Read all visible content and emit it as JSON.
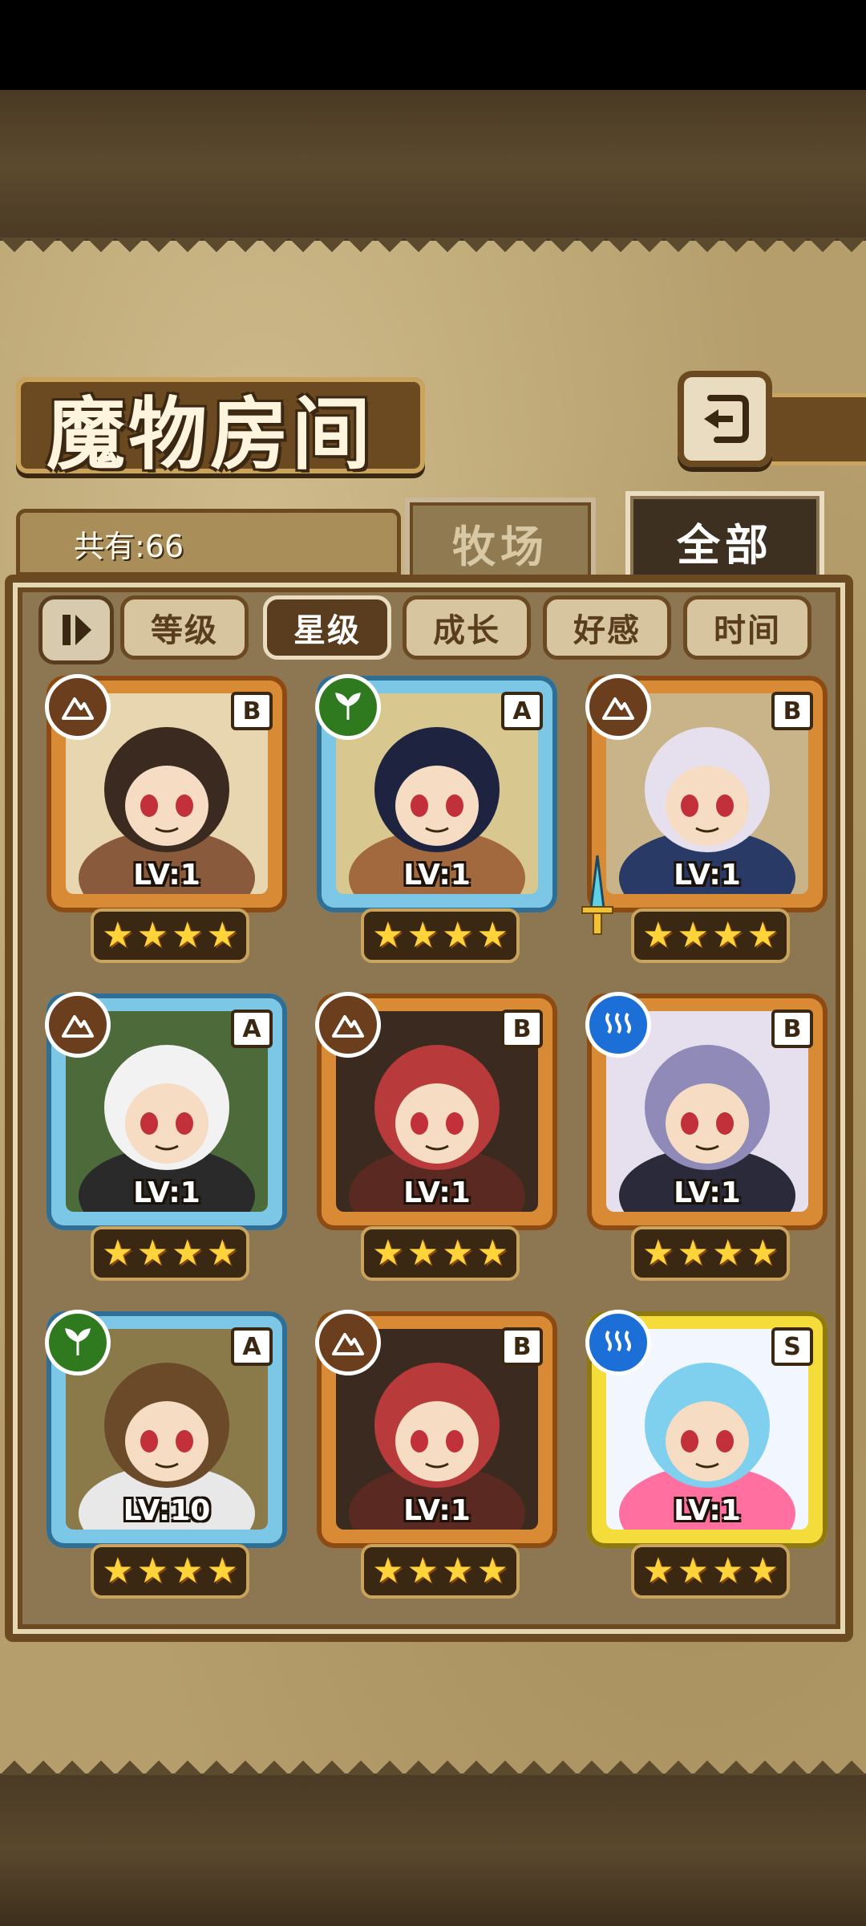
{
  "screen": {
    "title": "魔物房间",
    "count_label": "共有:66"
  },
  "tabs": [
    {
      "label": "牧场",
      "active": false
    },
    {
      "label": "全部",
      "active": true
    }
  ],
  "sort_buttons": [
    {
      "label": "等级",
      "active": false
    },
    {
      "label": "星级",
      "active": true
    },
    {
      "label": "成长",
      "active": false
    },
    {
      "label": "好感",
      "active": false
    },
    {
      "label": "时间",
      "active": false
    }
  ],
  "monsters": [
    {
      "rank": "B",
      "element": "earth-icon",
      "level": "LV:1",
      "stars": 4,
      "frame": "B",
      "colors": [
        "#3a2a20",
        "#8a5a3c",
        "#e8d6b0"
      ]
    },
    {
      "rank": "A",
      "element": "leaf-icon",
      "level": "LV:1",
      "stars": 4,
      "frame": "A",
      "colors": [
        "#1e2440",
        "#a2683e",
        "#d8c890"
      ]
    },
    {
      "rank": "B",
      "element": "earth-icon",
      "level": "LV:1",
      "stars": 4,
      "frame": "B",
      "colors": [
        "#e6e0ee",
        "#2a3a66",
        "#c9b48a"
      ]
    },
    {
      "rank": "A",
      "element": "earth-icon",
      "level": "LV:1",
      "stars": 4,
      "frame": "A",
      "colors": [
        "#f2f2f2",
        "#2a2a2a",
        "#4d6b3a"
      ]
    },
    {
      "rank": "B",
      "element": "earth-icon",
      "level": "LV:1",
      "stars": 4,
      "frame": "B",
      "colors": [
        "#b83a3a",
        "#5a2a22",
        "#3a2a20"
      ]
    },
    {
      "rank": "B",
      "element": "water-icon",
      "level": "LV:1",
      "stars": 4,
      "frame": "B",
      "colors": [
        "#8f8ab8",
        "#2a2a3a",
        "#e6e0ee"
      ]
    },
    {
      "rank": "A",
      "element": "leaf-icon",
      "level": "LV:10",
      "stars": 4,
      "frame": "A",
      "colors": [
        "#6b4a2a",
        "#e8e8e8",
        "#8a7a4a"
      ]
    },
    {
      "rank": "B",
      "element": "earth-icon",
      "level": "LV:1",
      "stars": 4,
      "frame": "B",
      "colors": [
        "#b83a3a",
        "#5a2a22",
        "#3a2a20"
      ]
    },
    {
      "rank": "S",
      "element": "water-icon",
      "level": "LV:1",
      "stars": 4,
      "frame": "S",
      "colors": [
        "#7fd0ee",
        "#ff6fa0",
        "#f2f6ff"
      ]
    }
  ]
}
